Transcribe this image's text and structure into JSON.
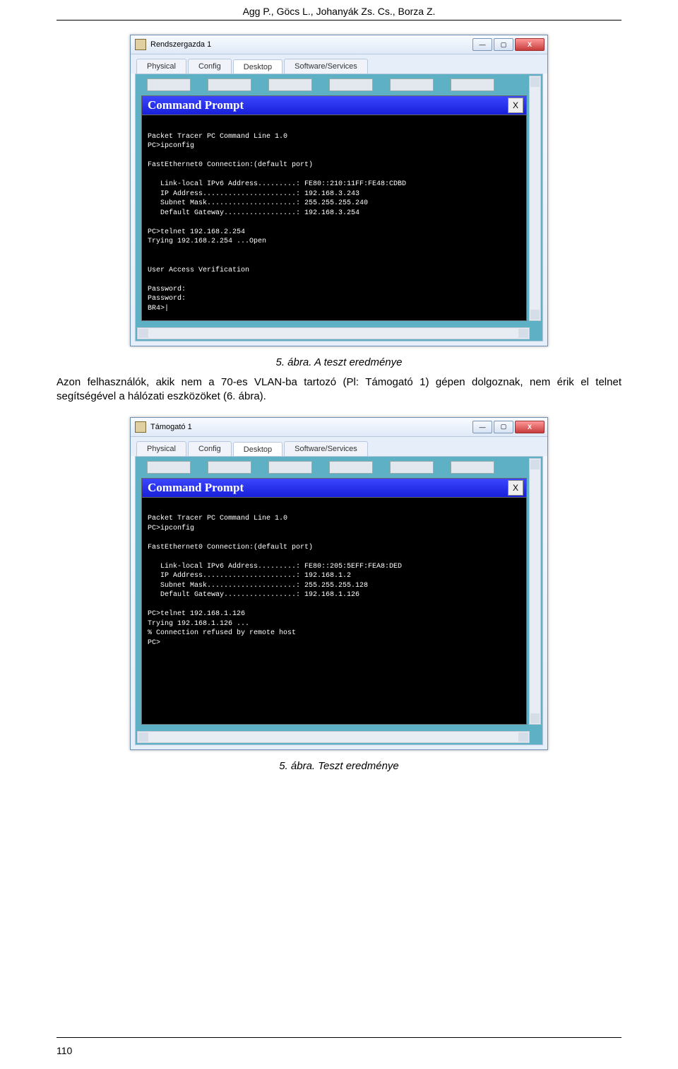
{
  "doc": {
    "header": "Agg P., Göcs L., Johanyák Zs. Cs., Borza Z.",
    "caption1": "5. ábra. A teszt eredménye",
    "paragraph": "Azon felhasználók, akik nem a 70-es VLAN-ba tartozó (Pl: Támogató 1) gépen dolgoznak, nem érik el telnet segítségével a hálózati eszközöket (6. ábra).",
    "caption2": "5.  ábra. Teszt eredménye",
    "page_number": "110"
  },
  "shared_ui": {
    "tabs": {
      "physical": "Physical",
      "config": "Config",
      "desktop": "Desktop",
      "software": "Software/Services"
    },
    "cmd_title": "Command Prompt",
    "cmd_close": "X",
    "win_min": "—",
    "win_max": "▢",
    "win_close": "X"
  },
  "figure1": {
    "win_title": "Rendszergazda 1",
    "terminal": "\nPacket Tracer PC Command Line 1.0\nPC>ipconfig\n\nFastEthernet0 Connection:(default port)\n\n   Link-local IPv6 Address.........: FE80::210:11FF:FE48:CDBD\n   IP Address......................: 192.168.3.243\n   Subnet Mask.....................: 255.255.255.240\n   Default Gateway.................: 192.168.3.254\n\nPC>telnet 192.168.2.254\nTrying 192.168.2.254 ...Open\n\n\nUser Access Verification\n\nPassword:\nPassword:\nBR4>|"
  },
  "figure2": {
    "win_title": "Támogató 1",
    "terminal": "\nPacket Tracer PC Command Line 1.0\nPC>ipconfig\n\nFastEthernet0 Connection:(default port)\n\n   Link-local IPv6 Address.........: FE80::205:5EFF:FEA8:DED\n   IP Address......................: 192.168.1.2\n   Subnet Mask.....................: 255.255.255.128\n   Default Gateway.................: 192.168.1.126\n\nPC>telnet 192.168.1.126\nTrying 192.168.1.126 ...\n% Connection refused by remote host\nPC>"
  }
}
